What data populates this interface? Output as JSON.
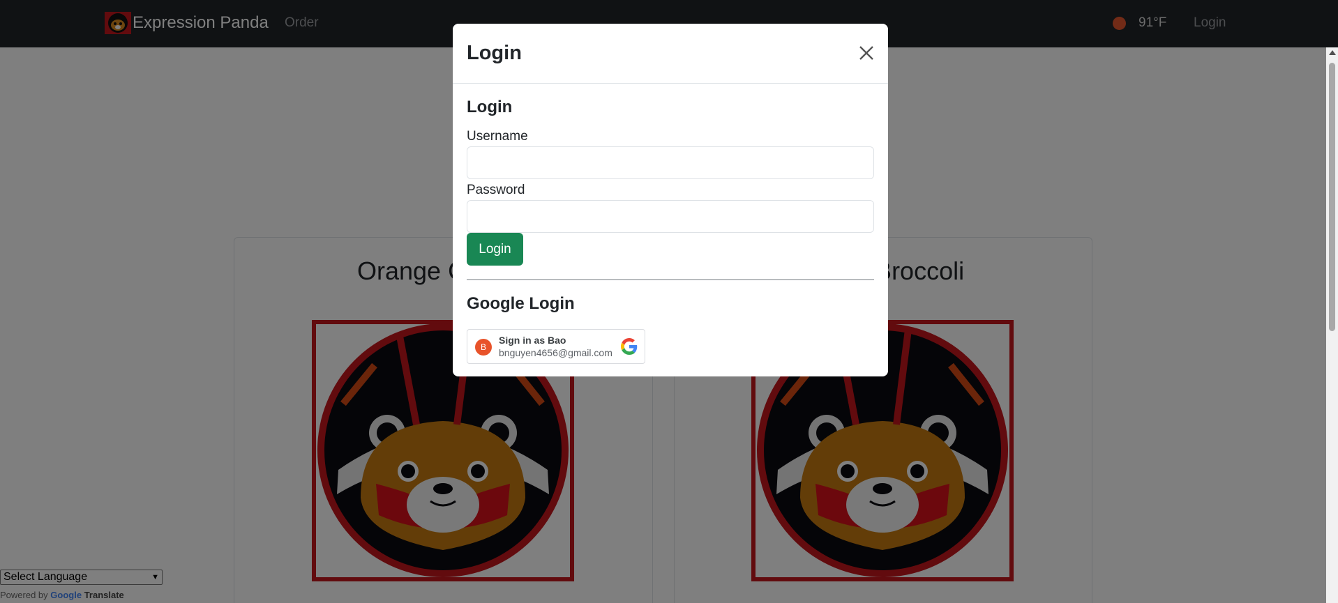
{
  "navbar": {
    "brand": "Expression Panda",
    "order": "Order",
    "temperature": "91°F",
    "login": "Login"
  },
  "page": {
    "card_left_title": "Orange Chicken",
    "card_right_title": "Beef Broccoli",
    "language_select": "Select Language",
    "powered_by": "Powered by",
    "google": "Google",
    "translate": "Translate"
  },
  "modal": {
    "title": "Login",
    "section_login": "Login",
    "username_label": "Username",
    "username_value": "",
    "password_label": "Password",
    "password_value": "",
    "login_button": "Login",
    "section_google": "Google Login",
    "google_account": {
      "avatar_initial": "B",
      "name": "Sign in as Bao",
      "email": "bnguyen4656@gmail.com"
    }
  },
  "colors": {
    "navbar_bg": "#212529",
    "login_button": "#198754",
    "weather_dot": "#e4572e",
    "avatar": "#e8532a",
    "panda_frame": "#c4161c"
  },
  "icons": {
    "close": "close-icon",
    "google": "google-g-icon",
    "logo": "panda-logo-icon"
  }
}
